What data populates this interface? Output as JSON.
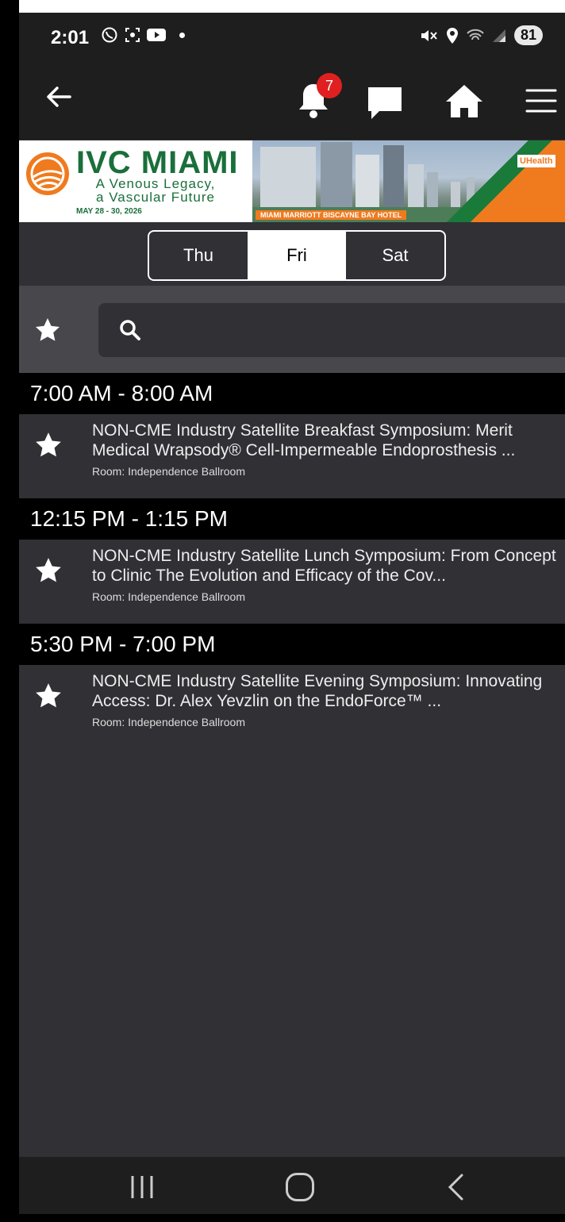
{
  "status_bar": {
    "time": "2:01",
    "battery": "81"
  },
  "app_bar": {
    "notification_count": "7"
  },
  "banner": {
    "title": "IVC MIAMI",
    "subtitle_line1": "A Venous Legacy,",
    "subtitle_line2": "a Vascular Future",
    "dates": "MAY 28 - 30, 2026",
    "hotel": "MIAMI MARRIOTT BISCAYNE BAY HOTEL",
    "sponsor": "UHealth"
  },
  "tabs": [
    {
      "label": "Thu",
      "active": false
    },
    {
      "label": "Fri",
      "active": true
    },
    {
      "label": "Sat",
      "active": false
    }
  ],
  "search": {
    "placeholder": "",
    "value": ""
  },
  "sessions": [
    {
      "time": "7:00 AM - 8:00 AM",
      "title": "NON-CME Industry Satellite Breakfast Symposium: Merit Medical Wrapsody® Cell-Impermeable Endoprosthesis ...",
      "room": "Room: Independence Ballroom"
    },
    {
      "time": "12:15 PM - 1:15 PM",
      "title": "NON-CME Industry Satellite Lunch Symposium: From Concept to Clinic The Evolution and Efficacy of the Cov...",
      "room": "Room: Independence Ballroom"
    },
    {
      "time": "5:30 PM - 7:00 PM",
      "title": "NON-CME Industry Satellite Evening Symposium: Innovating Access: Dr. Alex Yevzlin on the EndoForce™ ...",
      "room": "Room: Independence Ballroom"
    }
  ],
  "colors": {
    "brand_green": "#1a6f3a",
    "brand_orange": "#f07a1e",
    "badge_red": "#e02020",
    "background": "#303035"
  },
  "icons": [
    "back-arrow-icon",
    "bell-icon",
    "chat-icon",
    "home-icon",
    "menu-icon",
    "star-icon",
    "search-icon",
    "recents-icon",
    "home-circle-icon",
    "nav-back-icon"
  ]
}
